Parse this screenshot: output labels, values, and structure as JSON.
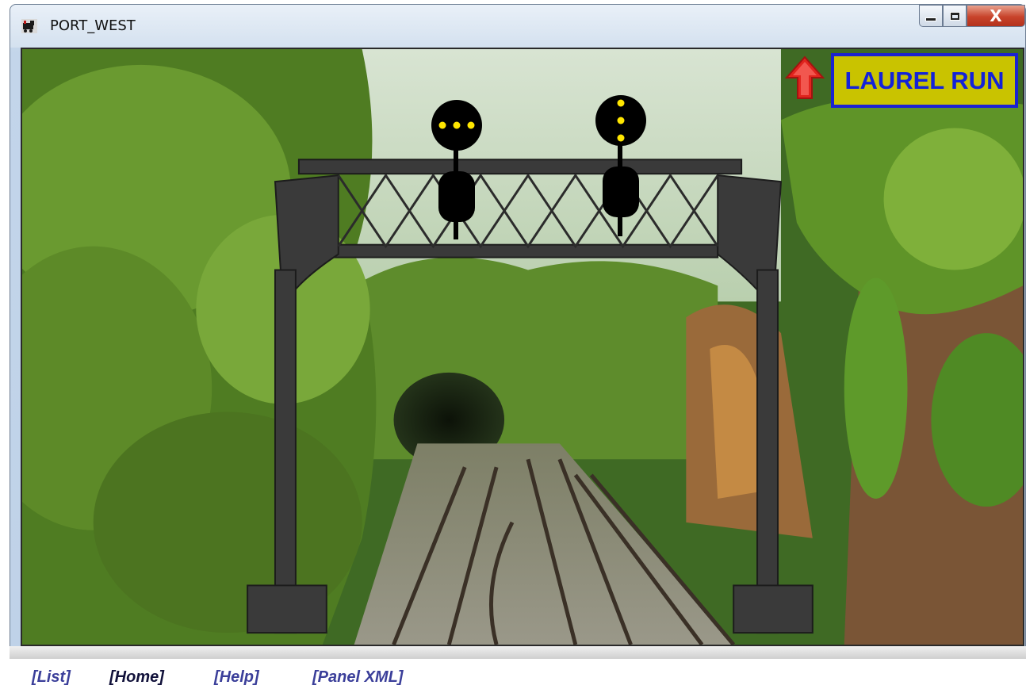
{
  "window": {
    "title": "PORT_WEST",
    "controls": {
      "close_glyph": "X"
    }
  },
  "panel": {
    "station_button": "LAUREL RUN",
    "nav_arrow_icon": "up-arrow-icon",
    "colors": {
      "station_bg": "#c9c300",
      "station_border": "#1b22d0",
      "aspect_lamp": "#ffe600",
      "arrow": "#e0241e"
    },
    "signals": [
      {
        "id": "left",
        "aspect": "horizontal"
      },
      {
        "id": "right",
        "aspect": "vertical"
      }
    ]
  },
  "links": {
    "list": "[List]",
    "home": "[Home]",
    "help": "[Help]",
    "panel_xml": "[Panel XML]"
  }
}
